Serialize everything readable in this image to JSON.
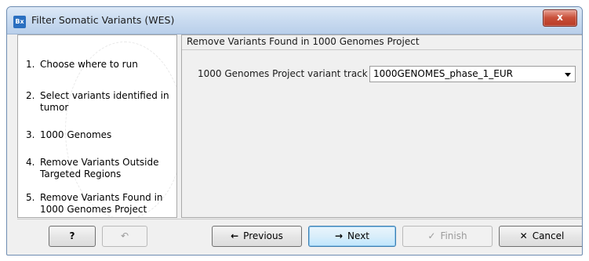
{
  "window": {
    "title": "Filter Somatic Variants (WES)",
    "app_icon_text": "Bx",
    "close_glyph": "x"
  },
  "steps": [
    {
      "num": "1.",
      "label": "Choose where to run"
    },
    {
      "num": "2.",
      "label": "Select variants identified in tumor"
    },
    {
      "num": "3.",
      "label": "1000 Genomes"
    },
    {
      "num": "4.",
      "label": "Remove Variants Outside Targeted Regions"
    },
    {
      "num": "5.",
      "label": "Remove Variants Found in 1000 Genomes Project"
    }
  ],
  "section": {
    "header": "Remove Variants Found in 1000 Genomes Project",
    "field_label": "1000 Genomes Project variant track",
    "selected_value": "1000GENOMES_phase_1_EUR"
  },
  "buttons": {
    "help": "?",
    "restore_glyph": "↶",
    "previous": "Previous",
    "previous_icon": "←",
    "next": "Next",
    "next_icon": "→",
    "finish": "Finish",
    "finish_icon": "✓",
    "cancel": "Cancel",
    "cancel_icon": "✕"
  }
}
